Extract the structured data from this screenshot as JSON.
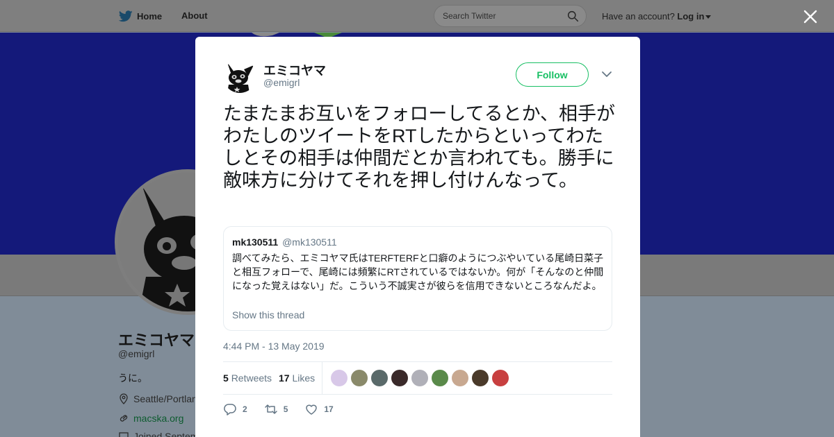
{
  "nav": {
    "home_label": "Home",
    "about_label": "About",
    "search_placeholder": "Search Twitter",
    "account_prompt": "Have an account?",
    "login_label": "Log in"
  },
  "profile": {
    "name": "エミコヤマ",
    "handle": "@emigrl",
    "bio": "うに。",
    "location": "Seattle/Portlan",
    "website": "macska.org",
    "joined": "Joined Septem",
    "banner_color": "#14197a"
  },
  "tweet": {
    "author_name": "エミコヤマ",
    "author_handle": "@emigrl",
    "follow_label": "Follow",
    "text": "たまたまお互いをフォローしてるとか、相手がわたしのツイートをRTしたからといってわたしとその相手は仲間だとか言われても。勝手に敵味方に分けてそれを押し付けんなって。",
    "quote": {
      "name": "mk130511",
      "handle": "@mk130511",
      "text": "調べてみたら、エミコヤマ氏はTERFTERFと口癖のようにつぶやいている尾崎日菜子と相互フォローで、尾崎には頻繁にRTされているではないか。何が「そんなのと仲間になった覚えはない」だ。こういう不誠実さが彼らを信用できないところなんだよ。",
      "thread_label": "Show this thread"
    },
    "timestamp": "4:44 PM - 13 May 2019",
    "retweets_count": "5",
    "retweets_label": "Retweets",
    "likes_count": "17",
    "likes_label": "Likes",
    "liker_colors": [
      "#d8c8e8",
      "#8a8a6a",
      "#5a6a6a",
      "#3a2a2a",
      "#b0b0b8",
      "#5a8a4a",
      "#c8a890",
      "#4a3a2a",
      "#c84040"
    ],
    "actions": {
      "reply_count": "2",
      "retweet_count": "5",
      "like_count": "17"
    },
    "accent_color": "#17bf63"
  }
}
